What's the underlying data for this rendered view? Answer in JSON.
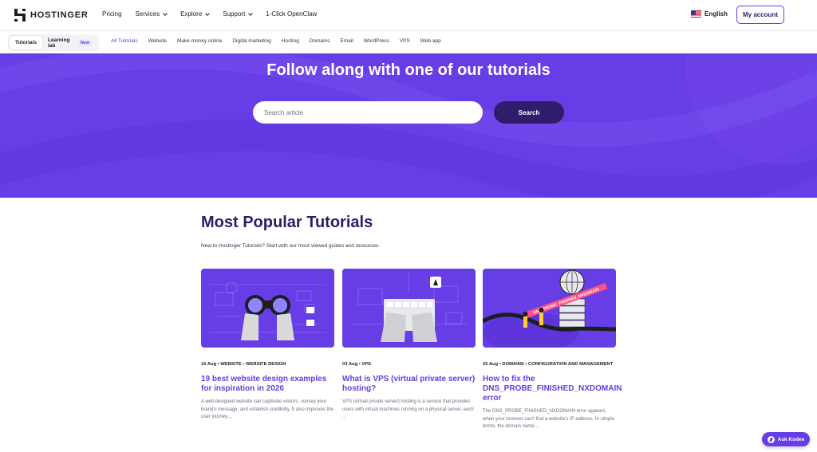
{
  "header": {
    "brand": "HOSTINGER",
    "menu": [
      {
        "label": "Pricing",
        "dropdown": false
      },
      {
        "label": "Services",
        "dropdown": true
      },
      {
        "label": "Explore",
        "dropdown": true
      },
      {
        "label": "Support",
        "dropdown": true
      },
      {
        "label": "1-Click OpenClaw",
        "dropdown": false
      }
    ],
    "language": "English",
    "account_button": "My account"
  },
  "subnav": {
    "segments": [
      {
        "label": "Tutorials",
        "active": true
      },
      {
        "label": "Learning lab",
        "badge": "New",
        "active": false
      }
    ],
    "categories": [
      {
        "label": "All Tutorials",
        "active": true
      },
      {
        "label": "Website"
      },
      {
        "label": "Make money online"
      },
      {
        "label": "Digital marketing"
      },
      {
        "label": "Hosting"
      },
      {
        "label": "Domains"
      },
      {
        "label": "Email"
      },
      {
        "label": "WordPress"
      },
      {
        "label": "VPS"
      },
      {
        "label": "Web app"
      }
    ]
  },
  "hero": {
    "title": "Follow along with one of our tutorials",
    "search_placeholder": "Search article",
    "search_button": "Search"
  },
  "popular": {
    "title": "Most Popular Tutorials",
    "subtitle": "New to Hostinger Tutorials? Start with our most-viewed guides and resources.",
    "cards": [
      {
        "date": "16 Aug",
        "tags": "WEBSITE • WEBSITE DESIGN",
        "title": "19 best website design examples for inspiration in 2026",
        "excerpt": "A well-designed website can captivate visitors, convey your brand's message, and establish credibility. It also improves the user journey,..."
      },
      {
        "date": "03 Aug",
        "tags": "VPS",
        "title": "What is VPS (virtual private server) hosting?",
        "excerpt": "VPS (virtual private server) hosting is a service that provides users with virtual machines running on a physical server, each ..."
      },
      {
        "date": "25 Aug",
        "tags": "DOMAINS • CONFIGURATION AND MANAGEMENT",
        "title": "How to fix the DNS_PROBE_FINISHED_NXDOMAIN error",
        "excerpt": "The DNS_PROBE_FINISHED_NXDOMAIN error appears when your browser can't find a website's IP address. In simple terms, the domain name..."
      }
    ],
    "card3_image_label": "DNS_PROBE_FINISHED_NXDOMAIN"
  },
  "assistant": {
    "label": "Ask Kodee"
  },
  "colors": {
    "brand": "#673de6",
    "dark": "#2f1c6a"
  }
}
